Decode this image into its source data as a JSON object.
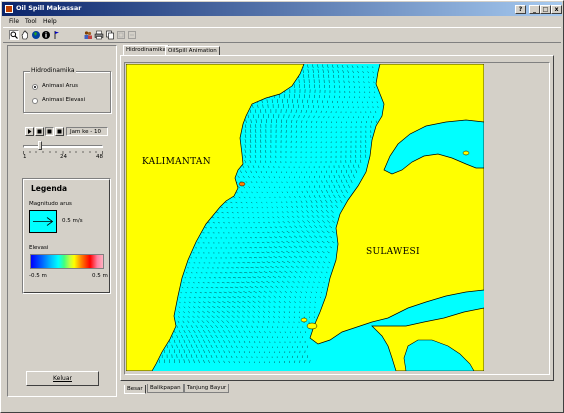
{
  "window": {
    "title": "Oil Spill Makassar",
    "controls": [
      "?",
      "_",
      "□",
      "x"
    ]
  },
  "menu": [
    "File",
    "Tool",
    "Help"
  ],
  "toolbar": {
    "tools": [
      "zoom-icon",
      "pan-hand-icon",
      "globe-icon",
      "info-icon",
      "flag-icon",
      "people-icon",
      "printer-icon",
      "copy-icon",
      "export-icon",
      "export2-icon"
    ]
  },
  "left_panel": {
    "hydro_group": {
      "title": "Hidrodinamika",
      "options": [
        "Animasi Arus",
        "Animasi Elevasi"
      ],
      "selected": "Animasi Arus"
    },
    "playback": {
      "buttons": [
        "play",
        "prev",
        "stop",
        "next"
      ],
      "status_label": "Jam ke - 10",
      "hour": 10,
      "slider_min": "1",
      "slider_mid": "24",
      "slider_max": "48"
    },
    "legend": {
      "title": "Legenda",
      "magnitude_label": "Magnitudo arus",
      "magnitude_value": "0.5 m/s",
      "elevation_label": "Elevasi",
      "elevation_min": "-0.5 m",
      "elevation_max": "0.5 m"
    },
    "exit_button": "Keluar"
  },
  "tabs": {
    "top": [
      "Hidrodinamika",
      "OilSpill Animation"
    ],
    "active_top": "Hidrodinamika",
    "bottom": [
      "Besar",
      "Balikpapan",
      "Tanjung Bayur"
    ],
    "active_bottom": "Besar"
  },
  "map": {
    "labels": {
      "west": "KALIMANTAN",
      "east": "SULAWESI"
    },
    "colors": {
      "land": "#ffff00",
      "sea": "#00ffff",
      "vectors": "#000000"
    }
  }
}
